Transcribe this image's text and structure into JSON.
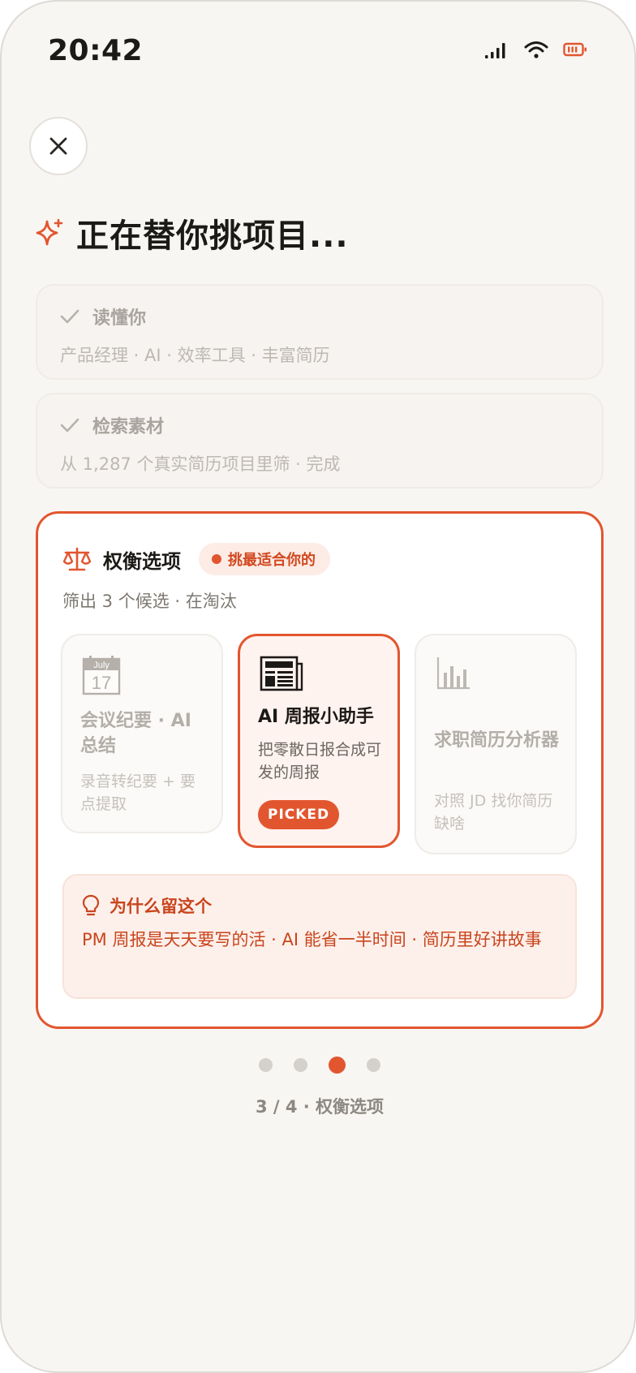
{
  "status_bar": {
    "time": "20:42"
  },
  "header": {
    "title": "正在替你挑项目..."
  },
  "steps": [
    {
      "title": "读懂你",
      "subtitle": "产品经理 · AI · 效率工具 · 丰富简历",
      "state": "done"
    },
    {
      "title": "检索素材",
      "subtitle": "从 1,287 个真实简历项目里筛 · 完成",
      "state": "done"
    }
  ],
  "panel": {
    "title": "权衡选项",
    "badge": "挑最适合你的",
    "subtitle": "筛出 3 个候选 · 在淘汰",
    "options": [
      {
        "icon": "calendar-icon",
        "calendar_month": "July",
        "calendar_day": "17",
        "title": "会议纪要 · AI 总结",
        "desc": "录音转纪要 + 要点提取",
        "state": "rejected"
      },
      {
        "icon": "newspaper-icon",
        "title": "AI 周报小助手",
        "desc": "把零散日报合成可发的周报",
        "state": "picked",
        "picked_label": "PICKED"
      },
      {
        "icon": "bar-chart-icon",
        "title": "求职简历分析器",
        "desc": "对照 JD 找你简历缺啥",
        "state": "rejected"
      }
    ],
    "why": {
      "title": "为什么留这个",
      "text": "PM 周报是天天要写的活 · AI 能省一半时间 · 简历里好讲故事"
    }
  },
  "pagination": {
    "current": 3,
    "total": 4,
    "label": "3 / 4 · 权衡选项"
  },
  "colors": {
    "accent": "#e2562f",
    "background": "#f8f6f3"
  }
}
